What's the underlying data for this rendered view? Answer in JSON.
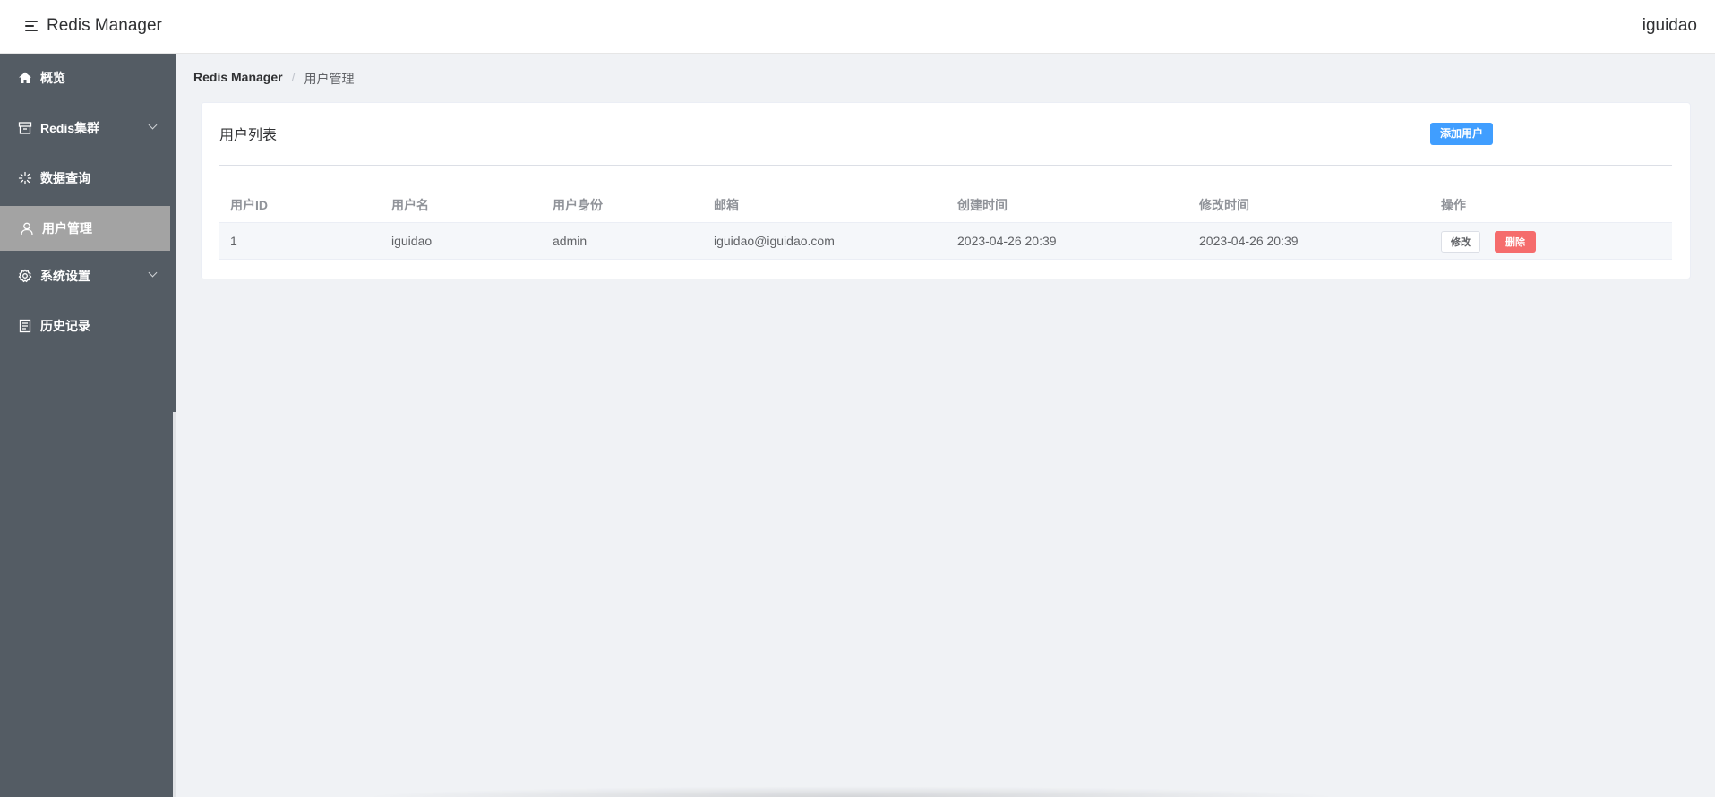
{
  "header": {
    "title": "Redis Manager",
    "username": "iguidao",
    "menu_icon": "menu-fold-icon"
  },
  "sidebar": {
    "items": [
      {
        "label": "概览",
        "icon": "home-icon",
        "active": false,
        "expandable": false
      },
      {
        "label": "Redis集群",
        "icon": "box-icon",
        "active": false,
        "expandable": true
      },
      {
        "label": "数据查询",
        "icon": "loading-icon",
        "active": false,
        "expandable": false
      },
      {
        "label": "用户管理",
        "icon": "user-icon",
        "active": true,
        "expandable": false
      },
      {
        "label": "系统设置",
        "icon": "gear-icon",
        "active": false,
        "expandable": true
      },
      {
        "label": "历史记录",
        "icon": "document-icon",
        "active": false,
        "expandable": false
      }
    ]
  },
  "breadcrumb": {
    "root": "Redis Manager",
    "separator": "/",
    "current": "用户管理"
  },
  "card": {
    "title": "用户列表",
    "add_button": "添加用户"
  },
  "table": {
    "headers": [
      "用户ID",
      "用户名",
      "用户身份",
      "邮箱",
      "创建时间",
      "修改时间",
      "操作"
    ],
    "rows": [
      {
        "id": "1",
        "username": "iguidao",
        "role": "admin",
        "email": "iguidao@iguidao.com",
        "created": "2023-04-26 20:39",
        "modified": "2023-04-26 20:39",
        "edit_label": "修改",
        "delete_label": "删除"
      }
    ]
  },
  "colors": {
    "sidebar_bg": "#545c64",
    "active_item_bg": "#a3a3a3",
    "primary": "#409eff",
    "danger": "#f56c6c"
  }
}
